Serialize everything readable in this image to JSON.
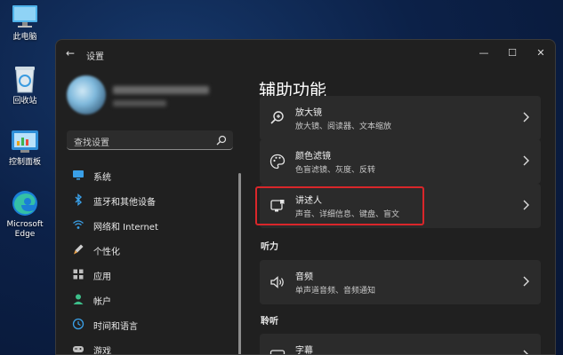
{
  "desktop": {
    "icons": [
      {
        "label": "此电脑"
      },
      {
        "label": "回收站"
      },
      {
        "label": "控制面板"
      },
      {
        "label": "Microsoft Edge"
      }
    ]
  },
  "window": {
    "title": "设置",
    "controls": {
      "minimize": "—",
      "maximize": "☐",
      "close": "✕"
    }
  },
  "search": {
    "placeholder": "查找设置"
  },
  "sidebar": {
    "items": [
      {
        "label": "系统",
        "icon": "monitor-icon"
      },
      {
        "label": "蓝牙和其他设备",
        "icon": "bluetooth-icon"
      },
      {
        "label": "网络和 Internet",
        "icon": "wifi-icon"
      },
      {
        "label": "个性化",
        "icon": "brush-icon"
      },
      {
        "label": "应用",
        "icon": "apps-icon"
      },
      {
        "label": "帐户",
        "icon": "person-icon"
      },
      {
        "label": "时间和语言",
        "icon": "globe-clock-icon"
      },
      {
        "label": "游戏",
        "icon": "gamepad-icon"
      }
    ]
  },
  "main": {
    "title": "辅助功能",
    "cards": [
      {
        "title": "放大镜",
        "subtitle": "放大镜、阅读器、文本缩放",
        "icon": "magnifier-icon"
      },
      {
        "title": "颜色滤镜",
        "subtitle": "色盲滤镜、灰度、反转",
        "icon": "palette-icon"
      },
      {
        "title": "讲述人",
        "subtitle": "声音、详细信息、键盘、盲文",
        "icon": "narrator-icon"
      },
      {
        "title": "音频",
        "subtitle": "单声道音频、音频通知",
        "icon": "speaker-icon"
      },
      {
        "title": "字幕",
        "subtitle": "",
        "icon": "captions-icon"
      }
    ],
    "sections": {
      "hearing": "听力",
      "listening": "聆听"
    }
  },
  "colors": {
    "accent": "#d9262a",
    "window_bg": "#202020",
    "card_bg": "#2b2b2b"
  }
}
